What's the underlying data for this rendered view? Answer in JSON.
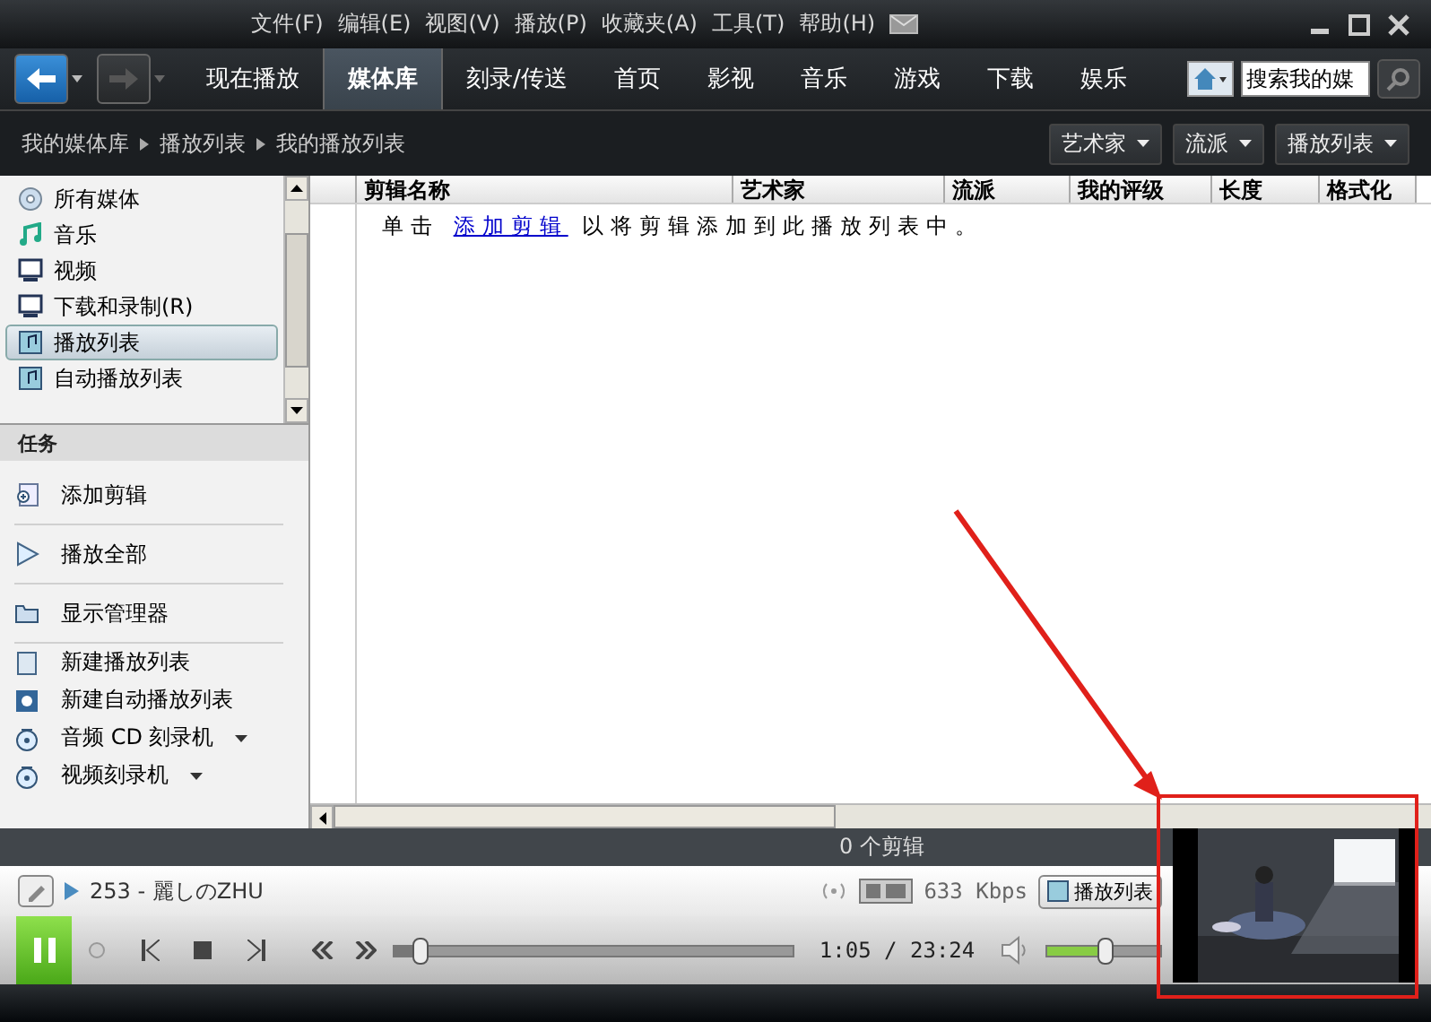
{
  "menu": [
    "文件(F)",
    "编辑(E)",
    "视图(V)",
    "播放(P)",
    "收藏夹(A)",
    "工具(T)",
    "帮助(H)"
  ],
  "nav_tabs": [
    {
      "label": "现在播放",
      "selected": false
    },
    {
      "label": "媒体库",
      "selected": true
    },
    {
      "label": "刻录/传送",
      "selected": false
    },
    {
      "label": "首页",
      "selected": false
    },
    {
      "label": "影视",
      "selected": false
    },
    {
      "label": "音乐",
      "selected": false
    },
    {
      "label": "游戏",
      "selected": false
    },
    {
      "label": "下载",
      "selected": false
    },
    {
      "label": "娱乐",
      "selected": false
    }
  ],
  "search": {
    "value": "搜索我的媒"
  },
  "breadcrumb": [
    "我的媒体库",
    "播放列表",
    "我的播放列表"
  ],
  "filters": [
    "艺术家",
    "流派",
    "播放列表"
  ],
  "library": [
    {
      "label": "所有媒体",
      "kind": "disc",
      "selected": false
    },
    {
      "label": "音乐",
      "kind": "music",
      "selected": false
    },
    {
      "label": "视频",
      "kind": "video",
      "selected": false
    },
    {
      "label": "下载和录制(R)",
      "kind": "video",
      "selected": false
    },
    {
      "label": "播放列表",
      "kind": "playlist",
      "selected": true
    },
    {
      "label": "自动播放列表",
      "kind": "playlist",
      "selected": false
    }
  ],
  "tasks_title": "任务",
  "tasks": [
    {
      "label": "添加剪辑",
      "kind": "add",
      "separator": true,
      "dropdown": false
    },
    {
      "label": "播放全部",
      "kind": "play",
      "separator": true,
      "dropdown": false
    },
    {
      "label": "显示管理器",
      "kind": "manager",
      "separator": true,
      "dropdown": false
    },
    {
      "label": "新建播放列表",
      "kind": "playlist",
      "separator": false,
      "dropdown": false
    },
    {
      "label": "新建自动播放列表",
      "kind": "autoplaylist",
      "separator": false,
      "dropdown": false
    },
    {
      "label": "音频 CD 刻录机",
      "kind": "burner",
      "separator": false,
      "dropdown": true
    },
    {
      "label": "视频刻录机",
      "kind": "burner",
      "separator": false,
      "dropdown": true
    }
  ],
  "columns": [
    "剪辑名称",
    "艺术家",
    "流派",
    "我的评级",
    "长度",
    "格式化"
  ],
  "message": {
    "before": "单击",
    "link": "添加剪辑",
    "after": "以将剪辑添加到此播放列表中。"
  },
  "status": "0 个剪辑",
  "now_playing": {
    "title": "253 - 麗しのZHU",
    "bitrate": "633 Kbps",
    "playlist_button": "播放列表"
  },
  "player": {
    "playing": true,
    "time": "1:05 / 23:24",
    "progress": {
      "level": 0.06
    },
    "volume": {
      "level": 0.5
    }
  }
}
